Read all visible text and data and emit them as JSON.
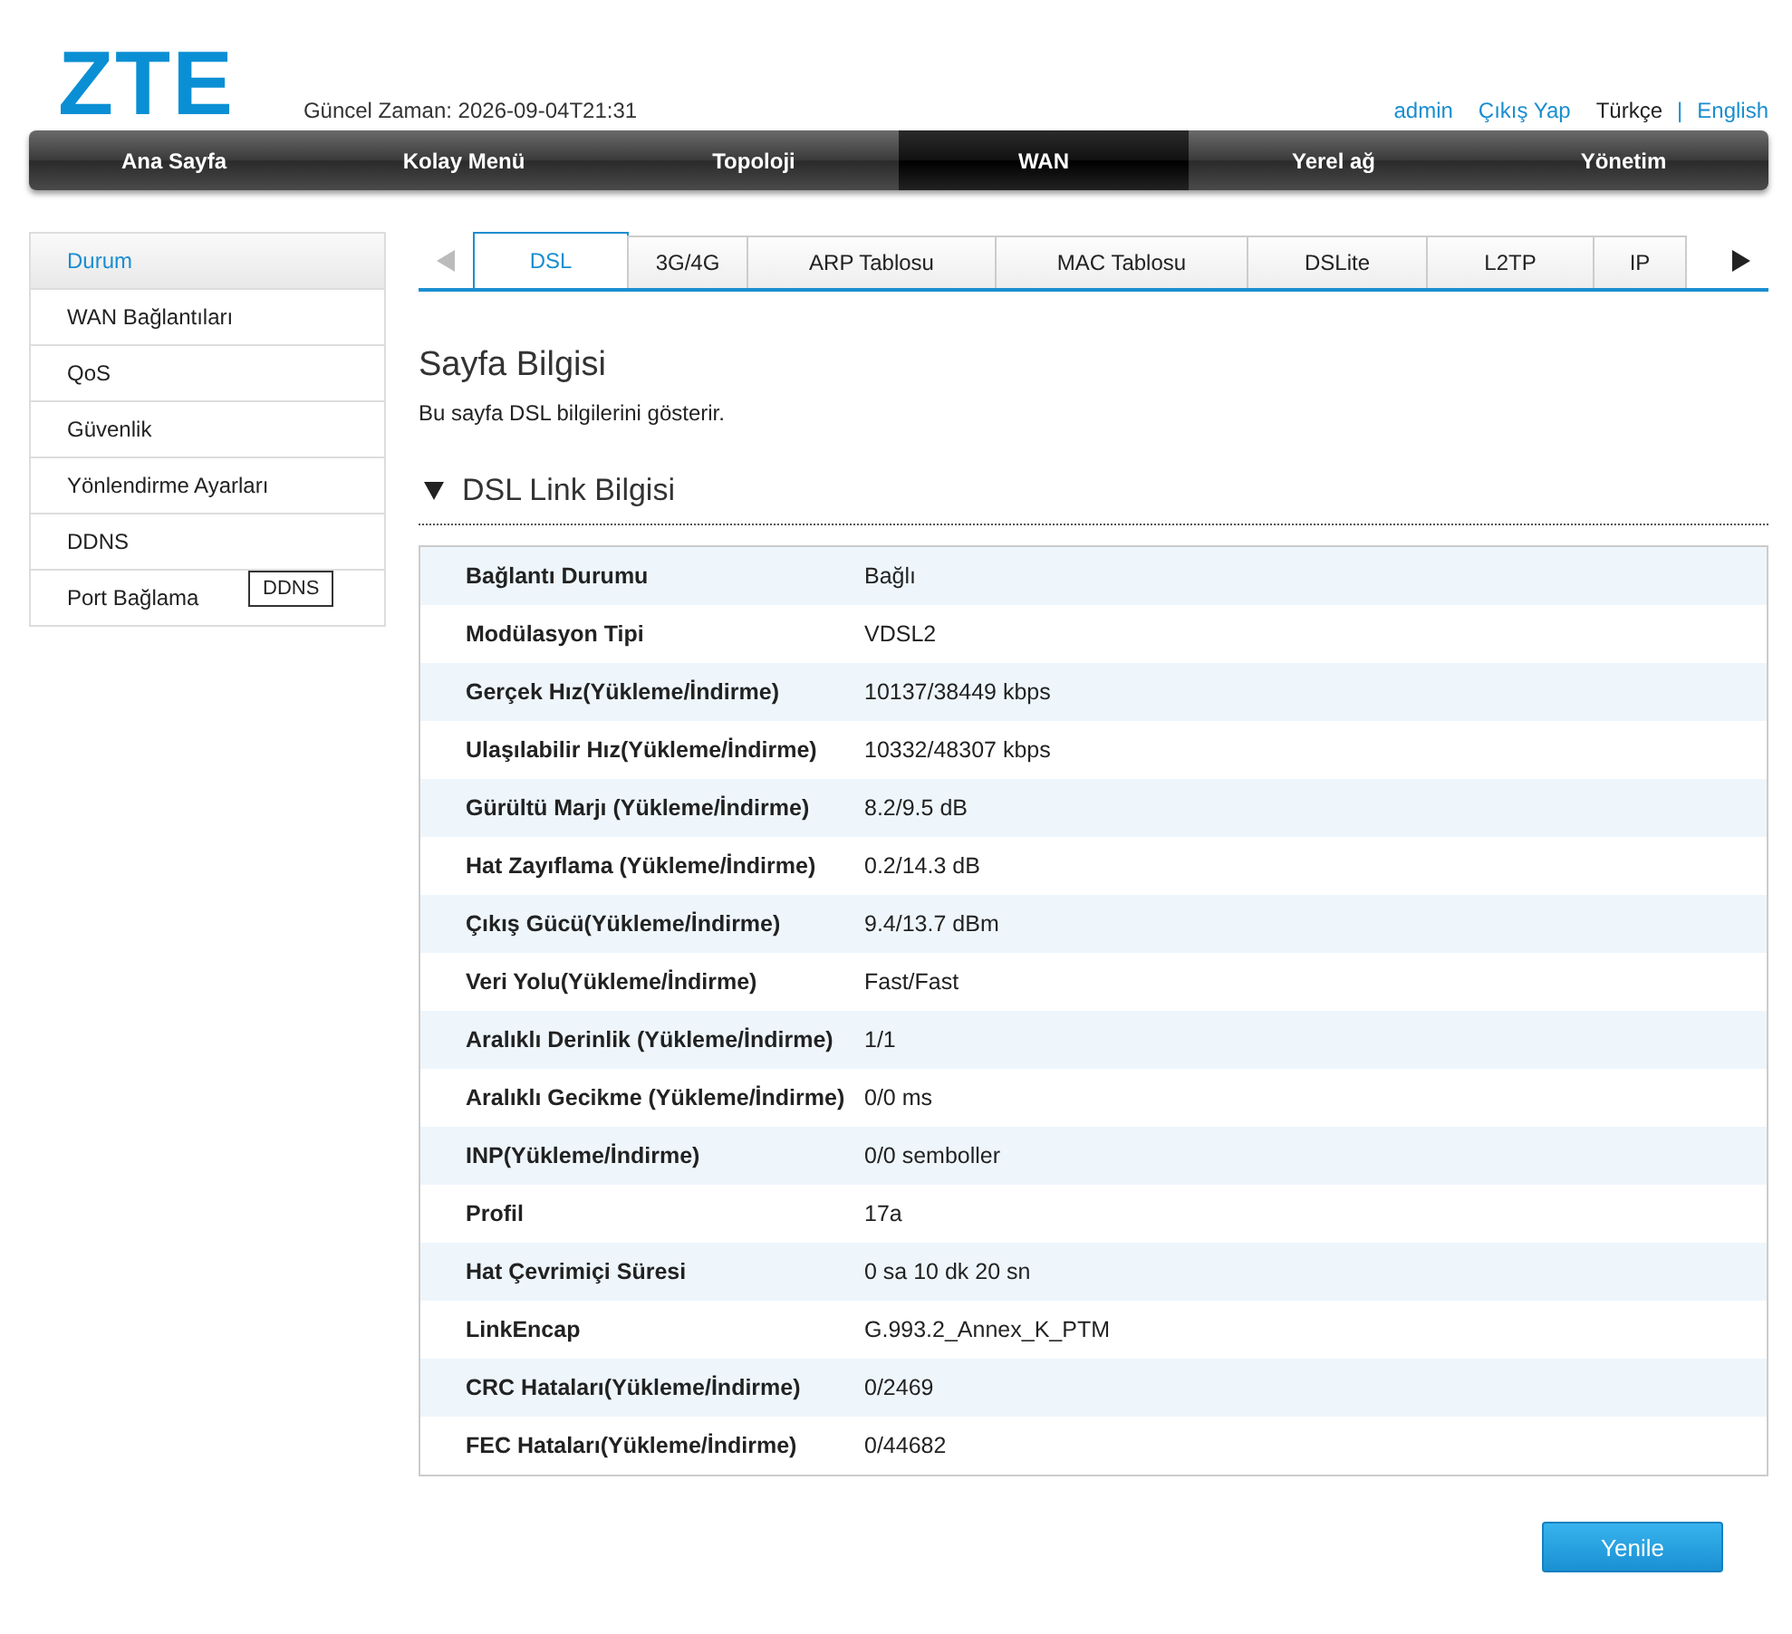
{
  "header": {
    "logo": "ZTE",
    "current_time": "Güncel Zaman: 2026-09-04T21:31",
    "links": [
      {
        "kind": "link",
        "label": "admin"
      },
      {
        "kind": "link",
        "label": "Çıkış Yap"
      },
      {
        "kind": "lang",
        "label": "Türkçe",
        "selected": true
      },
      {
        "kind": "separator",
        "label": "|"
      },
      {
        "kind": "lang",
        "label": "English",
        "selected": false
      }
    ]
  },
  "nav": [
    {
      "label": "Ana Sayfa",
      "selected": false
    },
    {
      "label": "Kolay Menü",
      "selected": false
    },
    {
      "label": "Topoloji",
      "selected": false
    },
    {
      "label": "WAN",
      "selected": true
    },
    {
      "label": "Yerel ağ",
      "selected": false
    },
    {
      "label": "Yönetim",
      "selected": false
    }
  ],
  "sidebar": {
    "items": [
      {
        "label": "Durum",
        "selected": true
      },
      {
        "label": "WAN Bağlantıları",
        "selected": false
      },
      {
        "label": "QoS",
        "selected": false
      },
      {
        "label": "Güvenlik",
        "selected": false
      },
      {
        "label": "Yönlendirme Ayarları",
        "selected": false
      },
      {
        "label": "DDNS",
        "selected": false
      },
      {
        "label": "Port Bağlama",
        "selected": false
      }
    ],
    "tooltip": "DDNS"
  },
  "tabs": [
    {
      "label": "DSL",
      "selected": true
    },
    {
      "label": "3G/4G",
      "selected": false
    },
    {
      "label": "ARP Tablosu",
      "selected": false
    },
    {
      "label": "MAC Tablosu",
      "selected": false
    },
    {
      "label": "DSLite",
      "selected": false
    },
    {
      "label": "L2TP",
      "selected": false
    },
    {
      "label": "IP",
      "selected": false
    }
  ],
  "page": {
    "title": "Sayfa Bilgisi",
    "description": "Bu sayfa DSL bilgilerini gösterir.",
    "section": {
      "title": "DSL Link Bilgisi",
      "expanded": true
    }
  },
  "table": {
    "rows": [
      {
        "label": "Bağlantı Durumu",
        "value": "Bağlı"
      },
      {
        "label": "Modülasyon Tipi",
        "value": "VDSL2"
      },
      {
        "label": "Gerçek Hız(Yükleme/İndirme)",
        "value": "10137/38449 kbps"
      },
      {
        "label": "Ulaşılabilir Hız(Yükleme/İndirme)",
        "value": "10332/48307 kbps"
      },
      {
        "label": "Gürültü Marjı (Yükleme/İndirme)",
        "value": "8.2/9.5 dB"
      },
      {
        "label": "Hat Zayıflama (Yükleme/İndirme)",
        "value": "0.2/14.3 dB"
      },
      {
        "label": "Çıkış Gücü(Yükleme/İndirme)",
        "value": "9.4/13.7 dBm"
      },
      {
        "label": "Veri Yolu(Yükleme/İndirme)",
        "value": "Fast/Fast"
      },
      {
        "label": "Aralıklı Derinlik (Yükleme/İndirme)",
        "value": "1/1"
      },
      {
        "label": "Aralıklı Gecikme (Yükleme/İndirme)",
        "value": "0/0 ms"
      },
      {
        "label": "INP(Yükleme/İndirme)",
        "value": "0/0 semboller"
      },
      {
        "label": "Profil",
        "value": "17a"
      },
      {
        "label": "Hat Çevrimiçi Süresi",
        "value": "0 sa 10 dk 20 sn"
      },
      {
        "label": "LinkEncap",
        "value": "G.993.2_Annex_K_PTM"
      },
      {
        "label": "CRC Hataları(Yükleme/İndirme)",
        "value": "0/2469"
      },
      {
        "label": "FEC Hataları(Yükleme/İndirme)",
        "value": "0/44682"
      }
    ]
  },
  "buttons": [
    {
      "label": "Yenile"
    }
  ]
}
